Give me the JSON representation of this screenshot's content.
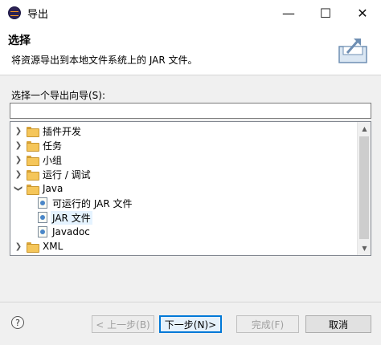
{
  "window": {
    "title": "导出",
    "min_symbol": "—",
    "max_symbol": "☐",
    "close_symbol": "✕"
  },
  "header": {
    "title": "选择",
    "description": "将资源导出到本地文件系统上的 JAR 文件。"
  },
  "wizard": {
    "prompt": "选择一个导出向导(S):",
    "filter_value": "",
    "tree": [
      {
        "label": "插件开发",
        "expanded": false
      },
      {
        "label": "任务",
        "expanded": false
      },
      {
        "label": "小组",
        "expanded": false
      },
      {
        "label": "运行 / 调试",
        "expanded": false
      },
      {
        "label": "Java",
        "expanded": true
      },
      {
        "label": "可运行的 JAR 文件"
      },
      {
        "label": "JAR 文件",
        "selected": true
      },
      {
        "label": "Javadoc"
      },
      {
        "label": "XML",
        "expanded": false
      }
    ]
  },
  "buttons": {
    "help": "?",
    "back": "< 上一步(B)",
    "next": "下一步(N)>",
    "finish": "完成(F)",
    "cancel": "取消"
  },
  "colors": {
    "accent": "#0078d7",
    "selection": "#e5f3ff"
  }
}
